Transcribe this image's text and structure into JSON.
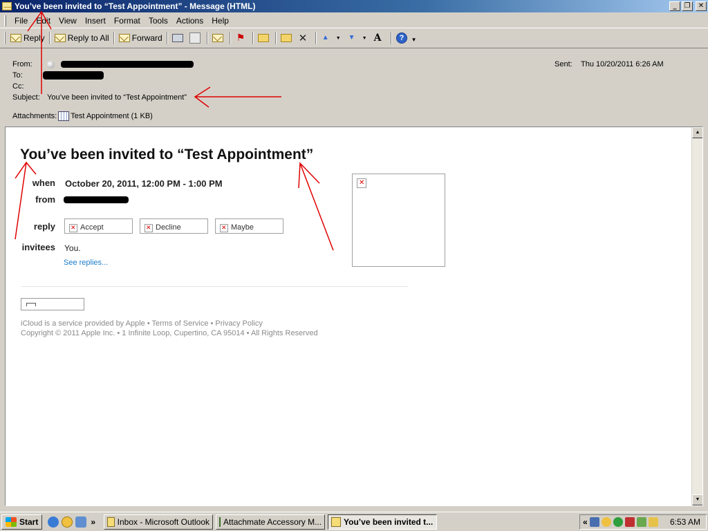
{
  "window": {
    "title": "You’ve been invited to “Test Appointment” - Message (HTML)",
    "controls": [
      "_",
      "❐",
      "✕"
    ]
  },
  "menu": [
    "File",
    "Edit",
    "View",
    "Insert",
    "Format",
    "Tools",
    "Actions",
    "Help"
  ],
  "toolbar": {
    "reply": "Reply",
    "reply_all": "Reply to All",
    "forward": "Forward"
  },
  "header": {
    "from_label": "From:",
    "to_label": "To:",
    "cc_label": "Cc:",
    "subject_label": "Subject:",
    "subject": "You’ve been invited to “Test Appointment”",
    "sent_label": "Sent:",
    "sent": "Thu 10/20/2011 6:26 AM",
    "attachments_label": "Attachments:",
    "attachment": "Test Appointment (1 KB)"
  },
  "invite": {
    "title": "You’ve been invited to “Test Appointment”",
    "when_label": "when",
    "when": "October 20, 2011, 12:00 PM - 1:00 PM",
    "from_label": "from",
    "reply_label": "reply",
    "accept": "Accept",
    "decline": "Decline",
    "maybe": "Maybe",
    "invitees_label": "invitees",
    "invitees": "You.",
    "see_replies": "See replies..."
  },
  "footer": {
    "line1": "iCloud is a service provided by Apple • Terms of Service • Privacy Policy",
    "line2": "Copyright © 2011 Apple Inc. • 1 Infinite Loop, Cupertino, CA 95014 • All Rights Reserved"
  },
  "taskbar": {
    "start": "Start",
    "overflow": "»",
    "tasks": [
      "Inbox - Microsoft Outlook",
      "Attachmate Accessory M...",
      "You’ve been invited t..."
    ],
    "tray_overflow": "«",
    "clock": "6:53 AM"
  },
  "colors": {
    "titlebar_start": "#0a246a",
    "link": "#1a7cc7",
    "annotation": "#e00000"
  }
}
